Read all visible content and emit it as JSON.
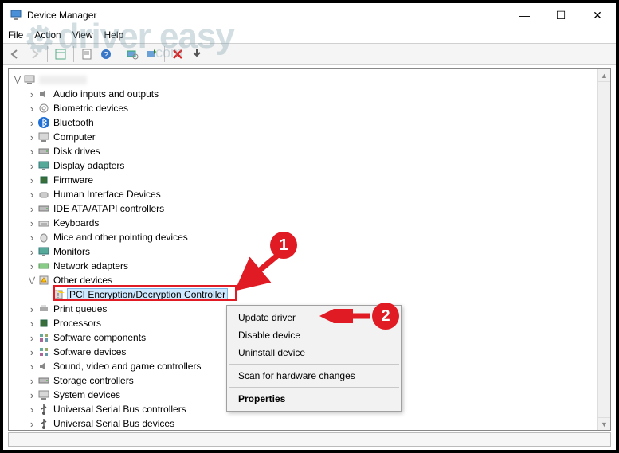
{
  "window": {
    "title": "Device Manager"
  },
  "menu": {
    "file": "File",
    "action": "Action",
    "view": "View",
    "help": "Help"
  },
  "watermark": {
    "text": "driver easy",
    "suffix": ".com"
  },
  "tree": {
    "root": "",
    "items": [
      "Audio inputs and outputs",
      "Biometric devices",
      "Bluetooth",
      "Computer",
      "Disk drives",
      "Display adapters",
      "Firmware",
      "Human Interface Devices",
      "IDE ATA/ATAPI controllers",
      "Keyboards",
      "Mice and other pointing devices",
      "Monitors",
      "Network adapters",
      "Other devices",
      "Print queues",
      "Processors",
      "Software components",
      "Software devices",
      "Sound, video and game controllers",
      "Storage controllers",
      "System devices",
      "Universal Serial Bus controllers",
      "Universal Serial Bus devices"
    ],
    "expanded_index": 13,
    "child": "PCI Encryption/Decryption Controller"
  },
  "context_menu": {
    "update": "Update driver",
    "disable": "Disable device",
    "uninstall": "Uninstall device",
    "scan": "Scan for hardware changes",
    "properties": "Properties"
  },
  "markers": {
    "one": "1",
    "two": "2"
  }
}
